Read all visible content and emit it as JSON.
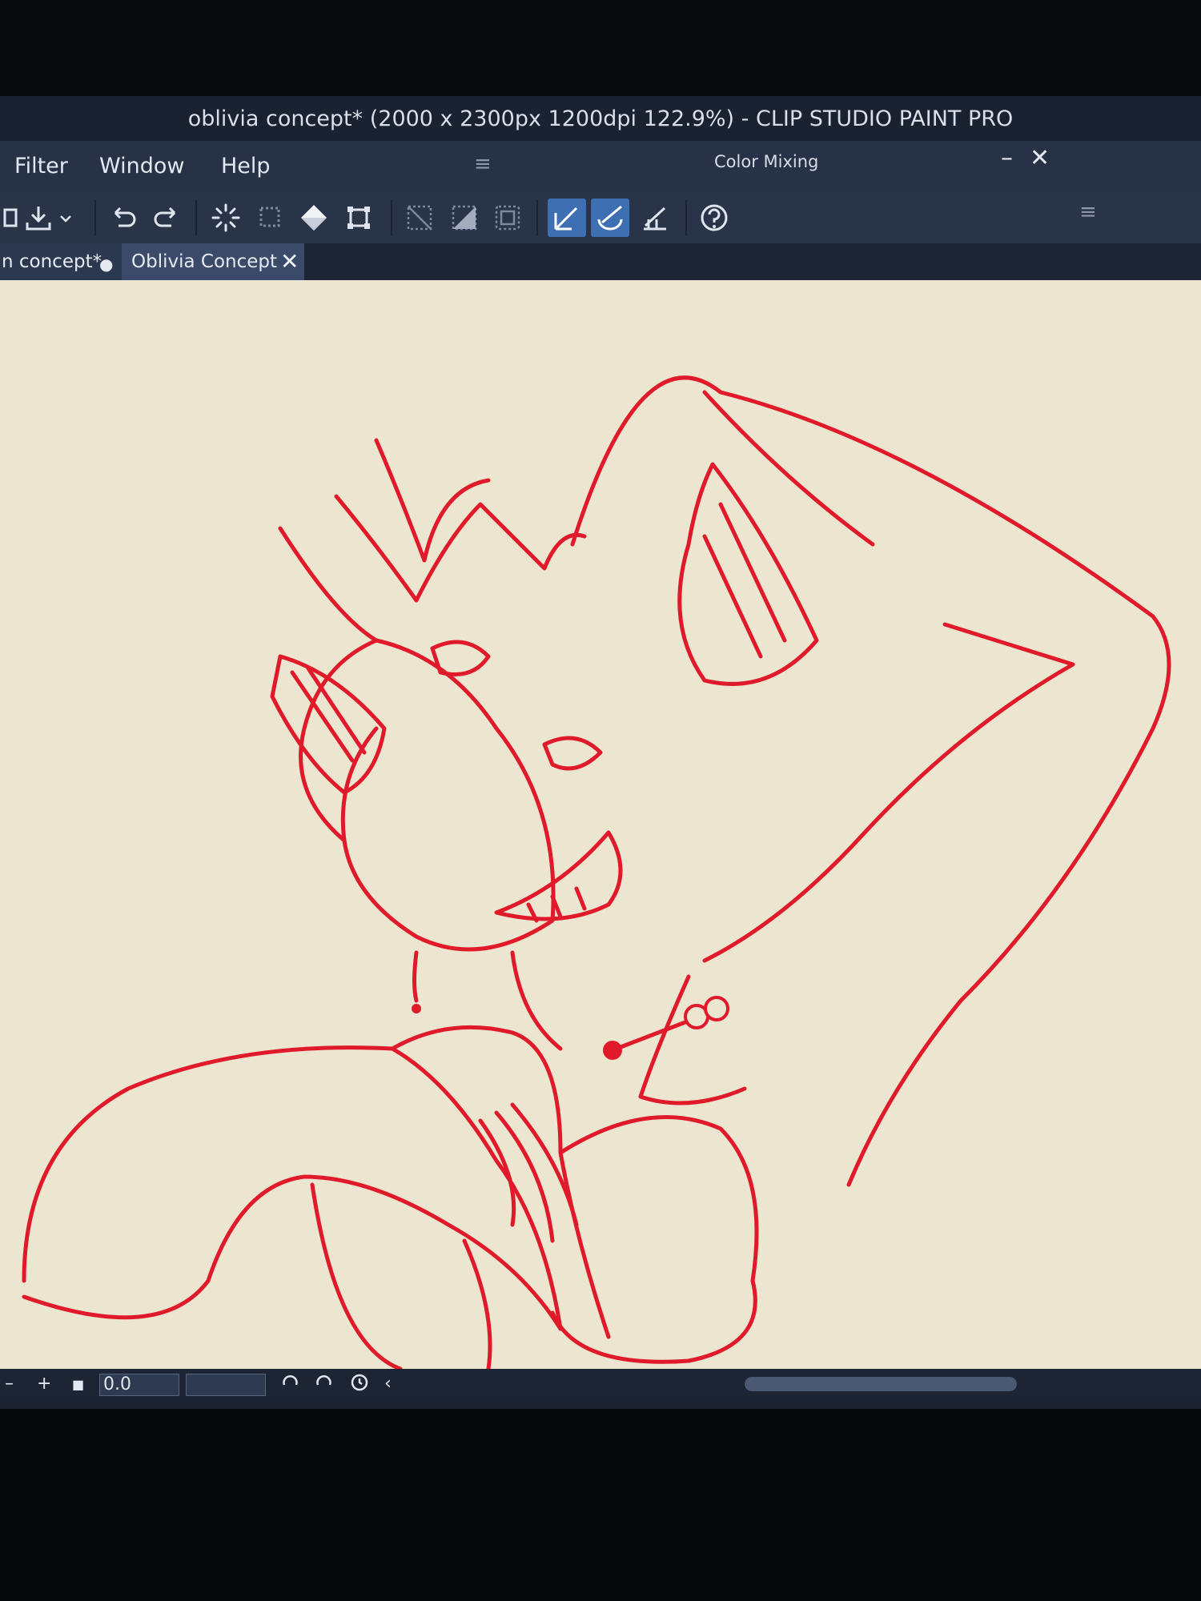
{
  "window": {
    "title": "oblivia concept* (2000 x 2300px 1200dpi 122.9%)  - CLIP STUDIO PAINT PRO"
  },
  "menu": {
    "items": [
      "Filter",
      "Window",
      "Help"
    ]
  },
  "panel": {
    "title": "Color Mixing",
    "minimize_glyph": "–",
    "close_glyph": "✕",
    "grip_glyph": "≡"
  },
  "toolbar": {
    "icons": [
      "save-icon",
      "export-icon",
      "dropdown-icon",
      "undo-icon",
      "redo-icon",
      "clear-icon",
      "clear-outside-icon",
      "fill-icon",
      "transform-icon",
      "deselect-icon",
      "invert-selection-icon",
      "show-selection-icon",
      "snap-ruler-icon",
      "snap-special-ruler-icon",
      "snap-grid-icon",
      "help-icon"
    ]
  },
  "tabs": [
    {
      "label": "n concept*",
      "modified_glyph": "●"
    },
    {
      "label": "Oblivia Concept",
      "close_glyph": "✕"
    }
  ],
  "statusbar": {
    "zoom_out": "–",
    "zoom_in": "+",
    "fit_glyph": "■",
    "zoom_value": "0.0",
    "left_glyph": "‹"
  },
  "colors": {
    "line_art": "#e01a2b",
    "paper": "#ece5cf",
    "accent": "#3e6fb2"
  }
}
